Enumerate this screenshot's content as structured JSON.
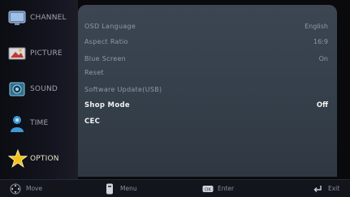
{
  "sidebar": {
    "items": [
      {
        "label": "CHANNEL",
        "icon": "channel-icon"
      },
      {
        "label": "PICTURE",
        "icon": "picture-icon"
      },
      {
        "label": "SOUND",
        "icon": "sound-icon"
      },
      {
        "label": "TIME",
        "icon": "time-icon"
      },
      {
        "label": "OPTION",
        "icon": "option-icon",
        "active": true
      }
    ]
  },
  "menu": {
    "rows": [
      {
        "key": "OSD Language",
        "value": "English"
      },
      {
        "key": "Aspect Ratio",
        "value": "16:9"
      },
      {
        "key": "Blue Screen",
        "value": "On"
      },
      {
        "key": "Reset",
        "value": ""
      },
      {
        "key": "Software Update(USB)",
        "value": ""
      },
      {
        "key": "Shop Mode",
        "value": "Off",
        "highlighted": true
      },
      {
        "key": "CEC",
        "value": "",
        "highlighted": true
      }
    ]
  },
  "footer": {
    "move": "Move",
    "menu": "Menu",
    "enter": "Enter",
    "exit": "Exit"
  },
  "colors": {
    "panel": "#3a444f",
    "highlight_text": "#f2f2f2",
    "dim_text": "#8e9aa6",
    "option_star": "#f2c21b"
  }
}
